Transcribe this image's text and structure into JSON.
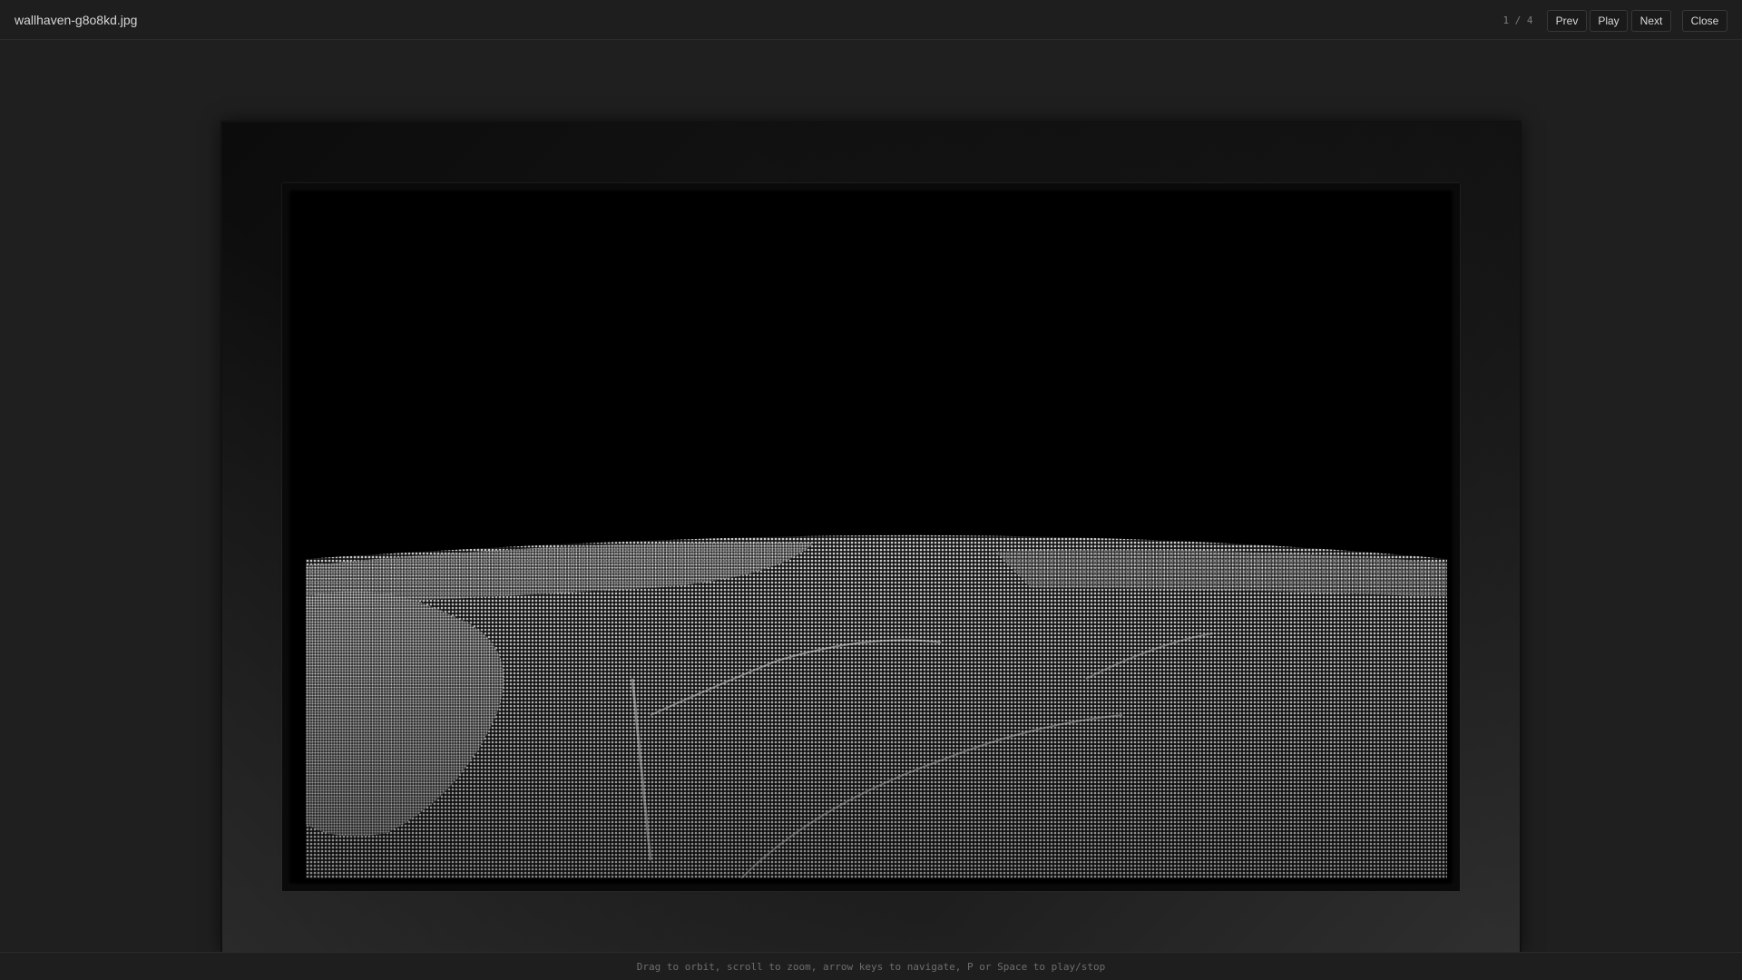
{
  "header": {
    "filename": "wallhaven-g8o8kd.jpg",
    "counter": "1 / 4",
    "prev_label": "Prev",
    "play_label": "Play",
    "next_label": "Next",
    "close_label": "Close"
  },
  "viewer": {
    "artwork_icon": "point-cloud-landscape-icon"
  },
  "footer": {
    "hint": "Drag to orbit, scroll to zoom, arrow keys to navigate, P or Space to play/stop"
  },
  "colors": {
    "background": "#1f1f1f",
    "bar": "#1e1e1e",
    "text": "#d6d6d6",
    "muted": "#6e6e6e"
  }
}
